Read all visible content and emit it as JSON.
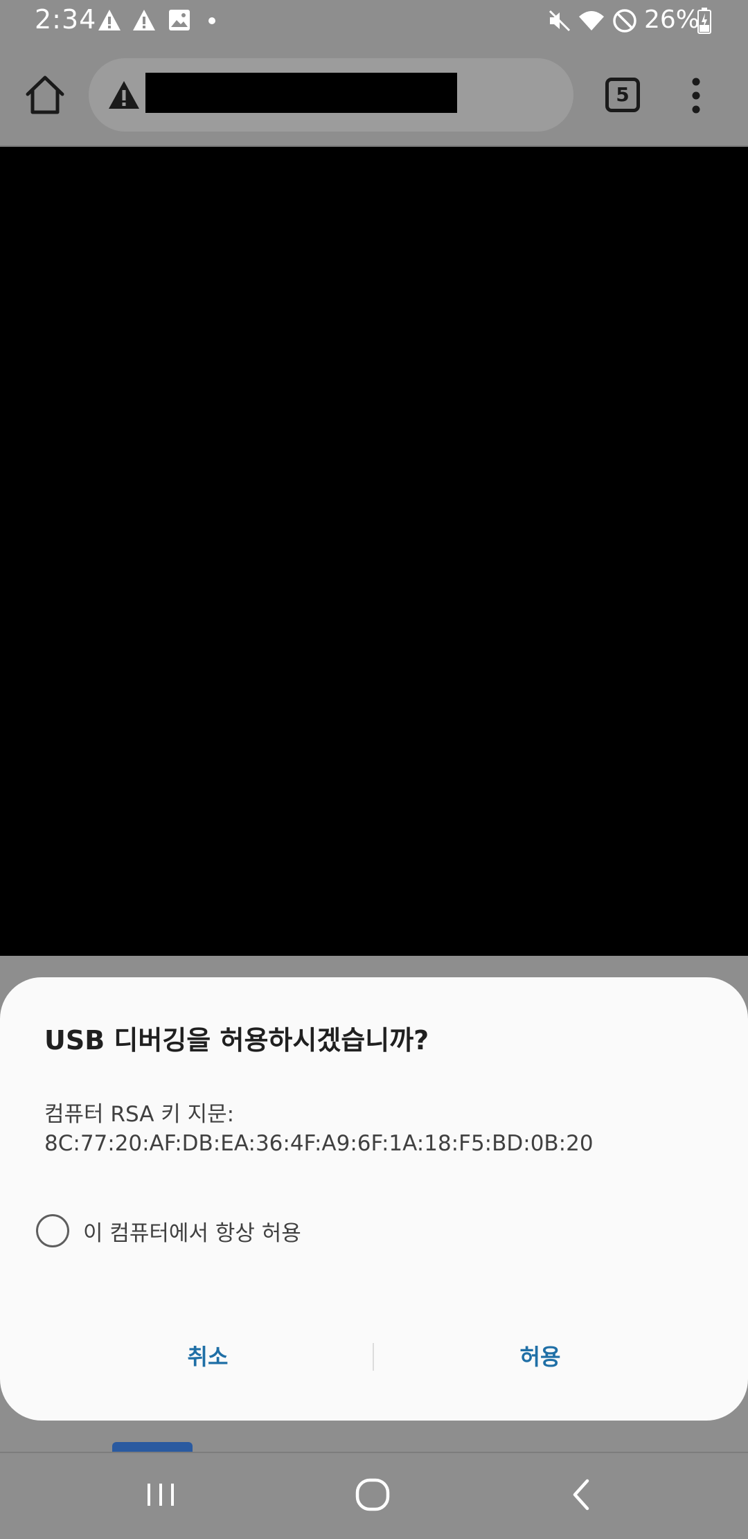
{
  "status_bar": {
    "time": "2:34",
    "battery": "26%",
    "icons": [
      "warning-icon",
      "warning-icon",
      "image-icon",
      "dot-icon",
      "mute-icon",
      "wifi-icon",
      "do-not-disturb-icon",
      "battery-charging-icon"
    ]
  },
  "toolbar": {
    "home_icon": "home-icon",
    "url_warning_icon": "warning-icon",
    "tabs_count": "5",
    "menu_icon": "more-vert-icon"
  },
  "dialog": {
    "title": "USB 디버깅을 허용하시겠습니까?",
    "body_label": "컴퓨터 RSA 키 지문:",
    "fingerprint": "8C:77:20:AF:DB:EA:36:4F:A9:6F:1A:18:F5:BD:0B:20",
    "always_allow_label": "이 컴퓨터에서 항상 허용",
    "cancel_label": "취소",
    "allow_label": "허용"
  },
  "nav_bar": {
    "recents_icon": "recents-icon",
    "home_icon": "home-circle-icon",
    "back_icon": "back-icon"
  },
  "colors": {
    "accent": "#1f6fa6",
    "scrim": "#8e8e8e",
    "dialog_bg": "#fafafa"
  }
}
